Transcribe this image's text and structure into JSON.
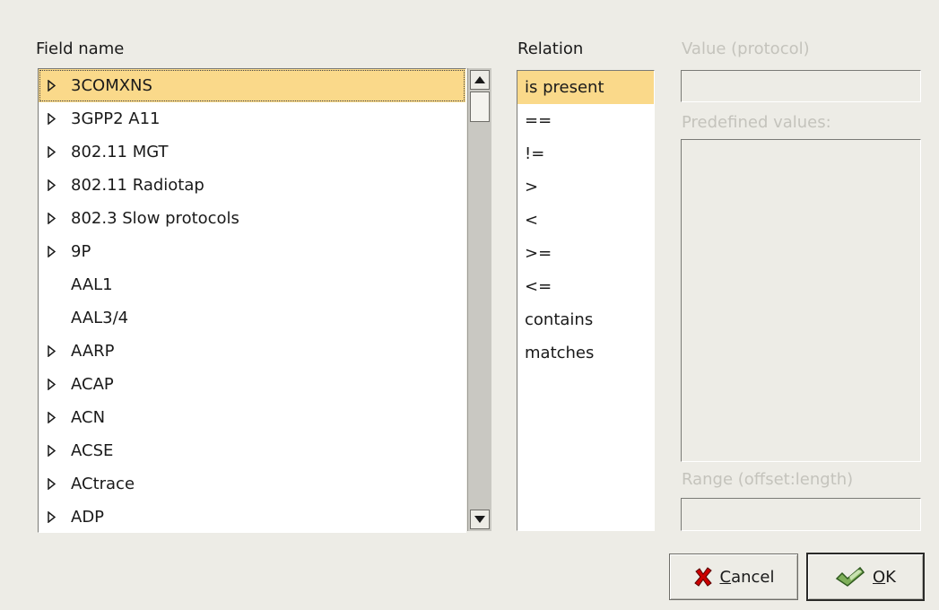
{
  "labels": {
    "field_name": "Field name",
    "relation": "Relation",
    "value": "Value (protocol)",
    "predefined": "Predefined values:",
    "range": "Range (offset:length)"
  },
  "fields": [
    {
      "label": "3COMXNS",
      "expandable": true,
      "selected": true
    },
    {
      "label": "3GPP2 A11",
      "expandable": true
    },
    {
      "label": "802.11 MGT",
      "expandable": true
    },
    {
      "label": "802.11 Radiotap",
      "expandable": true
    },
    {
      "label": "802.3 Slow protocols",
      "expandable": true
    },
    {
      "label": "9P",
      "expandable": true
    },
    {
      "label": "AAL1",
      "expandable": false
    },
    {
      "label": "AAL3/4",
      "expandable": false
    },
    {
      "label": "AARP",
      "expandable": true
    },
    {
      "label": "ACAP",
      "expandable": true
    },
    {
      "label": "ACN",
      "expandable": true
    },
    {
      "label": "ACSE",
      "expandable": true
    },
    {
      "label": "ACtrace",
      "expandable": true
    },
    {
      "label": "ADP",
      "expandable": true
    }
  ],
  "relations": [
    {
      "label": "is present",
      "selected": true
    },
    {
      "label": "=="
    },
    {
      "label": "!="
    },
    {
      "label": ">"
    },
    {
      "label": "<"
    },
    {
      "label": ">="
    },
    {
      "label": "<="
    },
    {
      "label": "contains"
    },
    {
      "label": "matches"
    }
  ],
  "inputs": {
    "value": "",
    "range": ""
  },
  "buttons": {
    "cancel_mnemonic": "C",
    "cancel_rest": "ancel",
    "ok_mnemonic": "O",
    "ok_rest": "K"
  },
  "icons": {
    "cancel": "cancel-x-icon",
    "ok": "ok-check-icon",
    "expander": "expander-triangle-icon",
    "scroll_up": "scroll-up-arrow-icon",
    "scroll_down": "scroll-down-arrow-icon"
  },
  "colors": {
    "selection": "#fad98a",
    "cancel_icon": "#cc0000",
    "ok_icon": "#3f7a2a"
  }
}
